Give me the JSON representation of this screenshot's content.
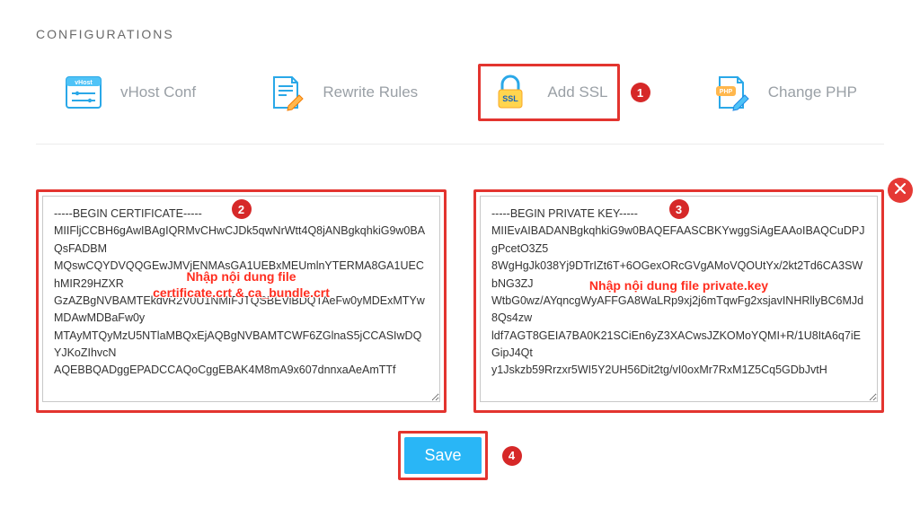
{
  "page_title": "CONFIGURATIONS",
  "tabs": {
    "vhost": {
      "label": "vHost Conf"
    },
    "rewrite": {
      "label": "Rewrite Rules"
    },
    "ssl": {
      "label": "Add SSL"
    },
    "php": {
      "label": "Change PHP"
    }
  },
  "markers": {
    "m1": "1",
    "m2": "2",
    "m3": "3",
    "m4": "4"
  },
  "cert_textarea": "-----BEGIN CERTIFICATE-----\nMIIFljCCBH6gAwIBAgIQRMvCHwCJDk5qwNrWtt4Q8jANBgkqhkiG9w0BAQsFADBM\nMQswCQYDVQQGEwJMVjENMAsGA1UEBxMEUmlnYTERMA8GA1UEChMIR29HZXR\nGzAZBgNVBAMTEkdvR2V0U1NMIFJTQSBEViBDQTAeFw0yMDExMTYwMDAwMDBaFw0y\nMTAyMTQyMzU5NTlaMBQxEjAQBgNVBAMTCWF6ZGlnaS5jCCASIwDQYJKoZIhvcN\nAQEBBQADggEPADCCAQoCggEBAK4M8mA9x607dnnxaAeAmTTf",
  "cert_overlay_line1": "Nhập nội dung file",
  "cert_overlay_line2": "certificate.crt & ca_bundle.crt",
  "key_textarea": "-----BEGIN PRIVATE KEY-----\nMIIEvAIBADANBgkqhkiG9w0BAQEFAASCBKYwggSiAgEAAoIBAQCuDPJgPcetO3Z5\n8WgHgJk038Yj9DTrIZt6T+6OGexORcGVgAMoVQOUtYx/2kt2Td6CA3SWbNG3ZJ\nWtbG0wz/AYqncgWyAFFGA8WaLRp9xj2j6mTqwFg2xsjavINHRllyBC6MJd8Qs4zw\nldf7AGT8GEIA7BA0K21SCiEn6yZ3XACwsJZKOMoYQMI+R/1U8ItA6q7iEGipJ4Qt\ny1Jskzb59Rrzxr5WI5Y2UH56Dit2tg/vI0oxMr7RxM1Z5Cq5GDbJvtH",
  "key_overlay": "Nhập nội dung file private.key",
  "save_label": "Save",
  "colors": {
    "highlight": "#e3342f",
    "marker": "#d62828",
    "button": "#29b6f6"
  }
}
